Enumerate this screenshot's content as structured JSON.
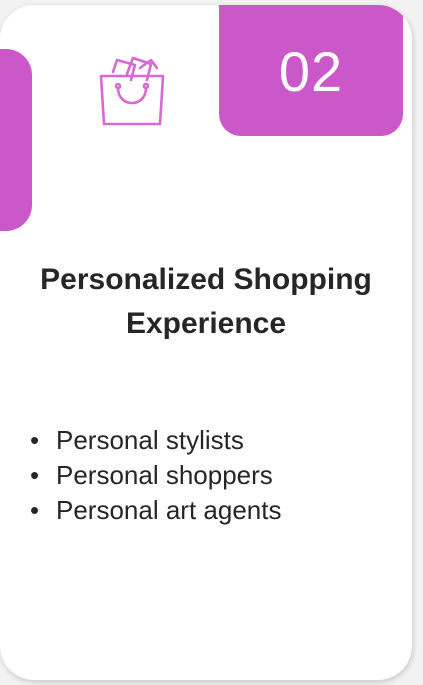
{
  "card": {
    "number": "02",
    "title_line1": "Personalized Shopping",
    "title_line2": "Experience",
    "items": [
      {
        "bullet": "•",
        "text": "Personal stylists"
      },
      {
        "bullet": "•",
        "text": "Personal shoppers"
      },
      {
        "bullet": "•",
        "text": "Personal art agents"
      }
    ],
    "icon": "shopping-bag-icon",
    "accent_color": "#cb58c9",
    "text_color": "#262626"
  }
}
